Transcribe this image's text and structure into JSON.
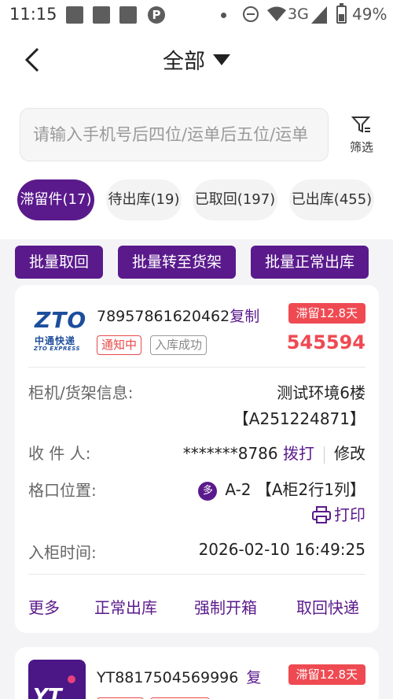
{
  "status_bar": {
    "time": "11:15",
    "network": "3G",
    "battery": "49%"
  },
  "header": {
    "title": "全部"
  },
  "search": {
    "placeholder": "请输入手机号后四位/运单后五位/运单",
    "filter_label": "筛选"
  },
  "tabs": [
    {
      "label": "滞留件(17)",
      "active": true
    },
    {
      "label": "待出库(19)",
      "active": false
    },
    {
      "label": "已取回(197)",
      "active": false
    },
    {
      "label": "已出库(455)",
      "active": false
    }
  ],
  "batch_actions": [
    {
      "label": "批量取回"
    },
    {
      "label": "批量转至货架"
    },
    {
      "label": "批量正常出库"
    }
  ],
  "colors": {
    "brand": "#5a1a8c",
    "alert": "#ef4a52"
  },
  "cards": [
    {
      "logo_text": "ZTO",
      "logo_cn": "中通快递",
      "logo_en": "ZTO EXPRESS",
      "tracking_no": "78957861620462",
      "copy_label": "复制",
      "stay_badge": "滞留12.8天",
      "tag_notify": "通知中",
      "tag_status": "入库成功",
      "pickup_code": "545594",
      "locker_label": "柜机/货架信息:",
      "locker_name": "测试环境6楼",
      "locker_id": "【A251224871】",
      "recipient_label": "收 件 人:",
      "recipient_phone": "*******8786",
      "call_label": "拨打",
      "edit_label": "修改",
      "slot_label": "格口位置:",
      "multi_badge": "多",
      "slot_value": "A-2 【A柜2行1列】",
      "print_label": "打印",
      "time_label": "入柜时间:",
      "time_value": "2026-02-10 16:49:25",
      "actions": [
        "更多",
        "正常出库",
        "强制开箱",
        "取回快递"
      ]
    },
    {
      "logo_text": "YT",
      "tracking_no": "YT8817504569996",
      "copy_label": "复",
      "stay_badge": "滞留12.8天"
    }
  ]
}
